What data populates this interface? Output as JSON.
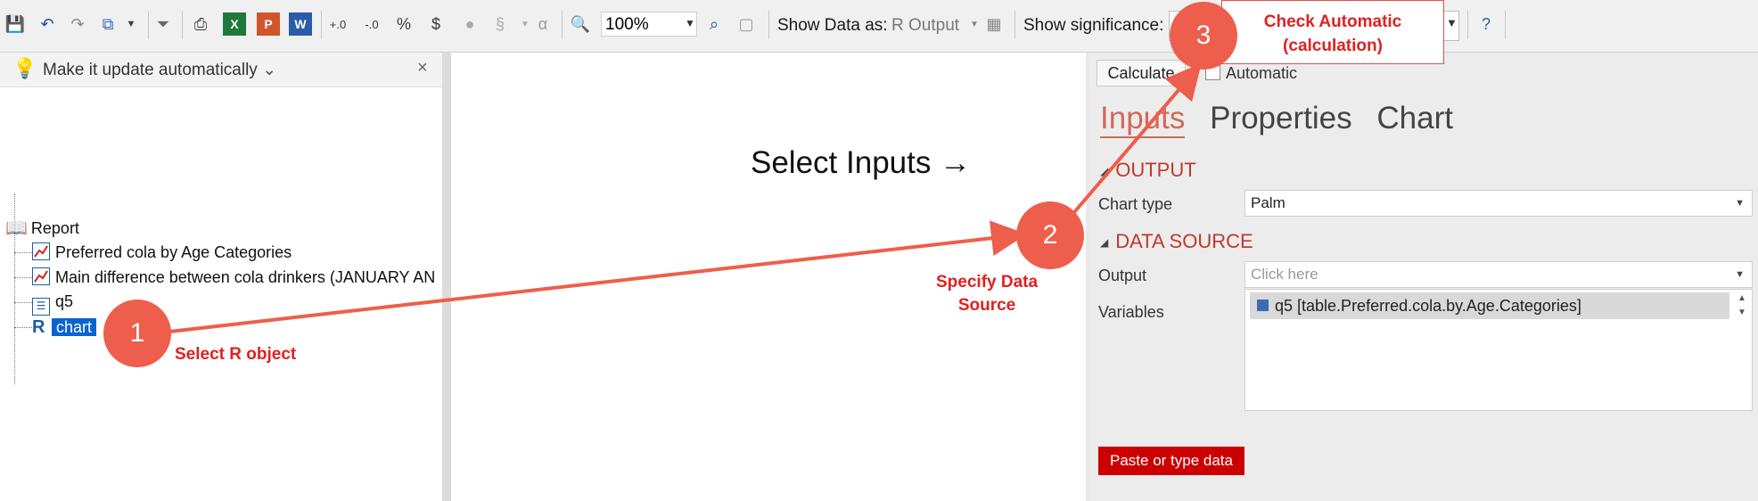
{
  "toolbar": {
    "zoom_value": "100%",
    "show_data_as_label": "Show Data as:",
    "show_data_as_value": "R Output",
    "show_significance_label": "Show significance:"
  },
  "tip": {
    "text": "Make it update automatically"
  },
  "tree": {
    "root": "Report",
    "items": [
      {
        "label": "Preferred cola by Age Categories",
        "icon": "chart-icon"
      },
      {
        "label": "Main difference between cola drinkers (JANUARY AN",
        "icon": "chart-icon"
      },
      {
        "label": "q5",
        "icon": "list-icon"
      },
      {
        "label": "chart",
        "icon": "r-icon",
        "selected": true
      }
    ]
  },
  "center": {
    "title": "Select Inputs →"
  },
  "right_panel": {
    "calculate_label": "Calculate",
    "automatic_label": "Automatic",
    "tabs": [
      "Inputs",
      "Properties",
      "Chart"
    ],
    "active_tab": "Inputs",
    "output_section": "OUTPUT",
    "chart_type_label": "Chart type",
    "chart_type_value": "Palm",
    "data_source_section": "DATA SOURCE",
    "output_label": "Output",
    "output_placeholder": "Click here",
    "variables_label": "Variables",
    "variable_item": "q5 [table.Preferred.cola.by.Age.Categories]",
    "paste_button": "Paste or type data"
  },
  "annotations": {
    "marker1": "1",
    "marker2": "2",
    "marker3": "3",
    "step1_text": "Select R object",
    "step2_text_line1": "Specify Data",
    "step2_text_line2": "Source",
    "step3_line1": "Check Automatic",
    "step3_line2": "(calculation)"
  },
  "colors": {
    "annotation_red": "#e02020",
    "marker_fill": "#ee5e4c",
    "selection_blue": "#0a64d0",
    "paste_button_red": "#cc0000"
  }
}
